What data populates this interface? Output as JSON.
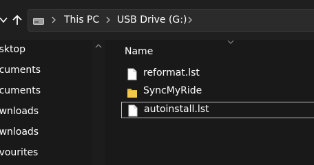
{
  "address_bar": {
    "breadcrumbs": [
      "This PC",
      "USB Drive (G:)"
    ]
  },
  "nav_pane": {
    "items": [
      "esktop",
      "ocuments",
      "ocuments",
      "ownloads",
      "ownloads",
      "avourites"
    ]
  },
  "file_list": {
    "column_header": "Name",
    "files": [
      {
        "name": "reformat.lst",
        "icon": "document-icon"
      },
      {
        "name": "SyncMyRide",
        "icon": "folder-icon"
      },
      {
        "name": "autoinstall.lst",
        "icon": "document-icon",
        "selected": true
      }
    ]
  },
  "colors": {
    "background": "#191919",
    "address_bar": "#2b2b2b",
    "folder": "#e8b73a",
    "selection_border": "#bfbfbf"
  }
}
